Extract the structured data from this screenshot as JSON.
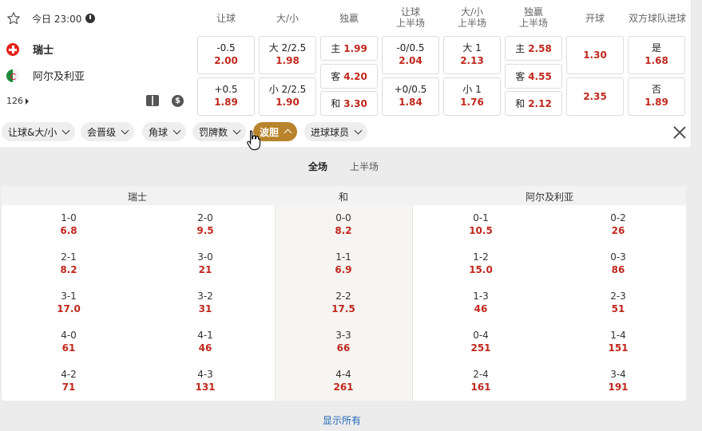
{
  "match": {
    "datetime": "今日 23:00",
    "home_team": "瑞士",
    "away_team": "阿尔及利亚",
    "markets_count": "126"
  },
  "columns": {
    "handicap": "让球",
    "over_under": "大/小",
    "win_1x2": "独赢",
    "handicap_half_1": "让球",
    "handicap_half_2": "上半场",
    "ou_half_1": "大/小",
    "ou_half_2": "上半场",
    "win_half_1": "独赢",
    "win_half_2": "上半场",
    "kickoff": "开球",
    "btts": "双方球队进球"
  },
  "odds": {
    "handicap": [
      {
        "label": "-0.5",
        "value": "2.00"
      },
      {
        "label": "+0.5",
        "value": "1.89"
      }
    ],
    "over_under": [
      {
        "label": "大 2/2.5",
        "value": "1.98"
      },
      {
        "label": "小 2/2.5",
        "value": "1.90"
      }
    ],
    "win_1x2": [
      {
        "label": "主",
        "value": "1.99"
      },
      {
        "label": "客",
        "value": "4.20"
      },
      {
        "label": "和",
        "value": "3.30"
      }
    ],
    "handicap_half": [
      {
        "label": "-0/0.5",
        "value": "2.04"
      },
      {
        "label": "+0/0.5",
        "value": "1.84"
      }
    ],
    "ou_half": [
      {
        "label": "大 1",
        "value": "2.13"
      },
      {
        "label": "小 1",
        "value": "1.76"
      }
    ],
    "win_half": [
      {
        "label": "主",
        "value": "2.58"
      },
      {
        "label": "客",
        "value": "4.55"
      },
      {
        "label": "和",
        "value": "2.12"
      }
    ],
    "kickoff": [
      {
        "value": "1.30"
      },
      {
        "value": "2.35"
      }
    ],
    "btts": [
      {
        "label": "是",
        "value": "1.68"
      },
      {
        "label": "否",
        "value": "1.89"
      }
    ]
  },
  "filters": [
    {
      "label": "让球&大/小",
      "active": false
    },
    {
      "label": "会晋级",
      "active": false
    },
    {
      "label": "角球",
      "active": false
    },
    {
      "label": "罚牌数",
      "active": false
    },
    {
      "label": "波胆",
      "active": true
    },
    {
      "label": "进球球员",
      "active": false
    }
  ],
  "period_tabs": {
    "full": "全场",
    "first_half": "上半场"
  },
  "correct_score": {
    "headers": {
      "home": "瑞士",
      "draw": "和",
      "away": "阿尔及利亚"
    },
    "home_a": [
      {
        "score": "1-0",
        "odds": "6.8"
      },
      {
        "score": "2-1",
        "odds": "8.2"
      },
      {
        "score": "3-1",
        "odds": "17.0"
      },
      {
        "score": "4-0",
        "odds": "61"
      },
      {
        "score": "4-2",
        "odds": "71"
      }
    ],
    "home_b": [
      {
        "score": "2-0",
        "odds": "9.5"
      },
      {
        "score": "3-0",
        "odds": "21"
      },
      {
        "score": "3-2",
        "odds": "31"
      },
      {
        "score": "4-1",
        "odds": "46"
      },
      {
        "score": "4-3",
        "odds": "131"
      }
    ],
    "draw": [
      {
        "score": "0-0",
        "odds": "8.2"
      },
      {
        "score": "1-1",
        "odds": "6.9"
      },
      {
        "score": "2-2",
        "odds": "17.5"
      },
      {
        "score": "3-3",
        "odds": "66"
      },
      {
        "score": "4-4",
        "odds": "261"
      }
    ],
    "away_a": [
      {
        "score": "0-1",
        "odds": "10.5"
      },
      {
        "score": "1-2",
        "odds": "15.0"
      },
      {
        "score": "1-3",
        "odds": "46"
      },
      {
        "score": "0-4",
        "odds": "251"
      },
      {
        "score": "2-4",
        "odds": "161"
      }
    ],
    "away_b": [
      {
        "score": "0-2",
        "odds": "26"
      },
      {
        "score": "0-3",
        "odds": "86"
      },
      {
        "score": "2-3",
        "odds": "51"
      },
      {
        "score": "1-4",
        "odds": "151"
      },
      {
        "score": "3-4",
        "odds": "191"
      }
    ]
  },
  "show_all": "显示所有",
  "colors": {
    "accent": "#b8842b",
    "odds": "#c0281d",
    "link": "#2266b8"
  }
}
